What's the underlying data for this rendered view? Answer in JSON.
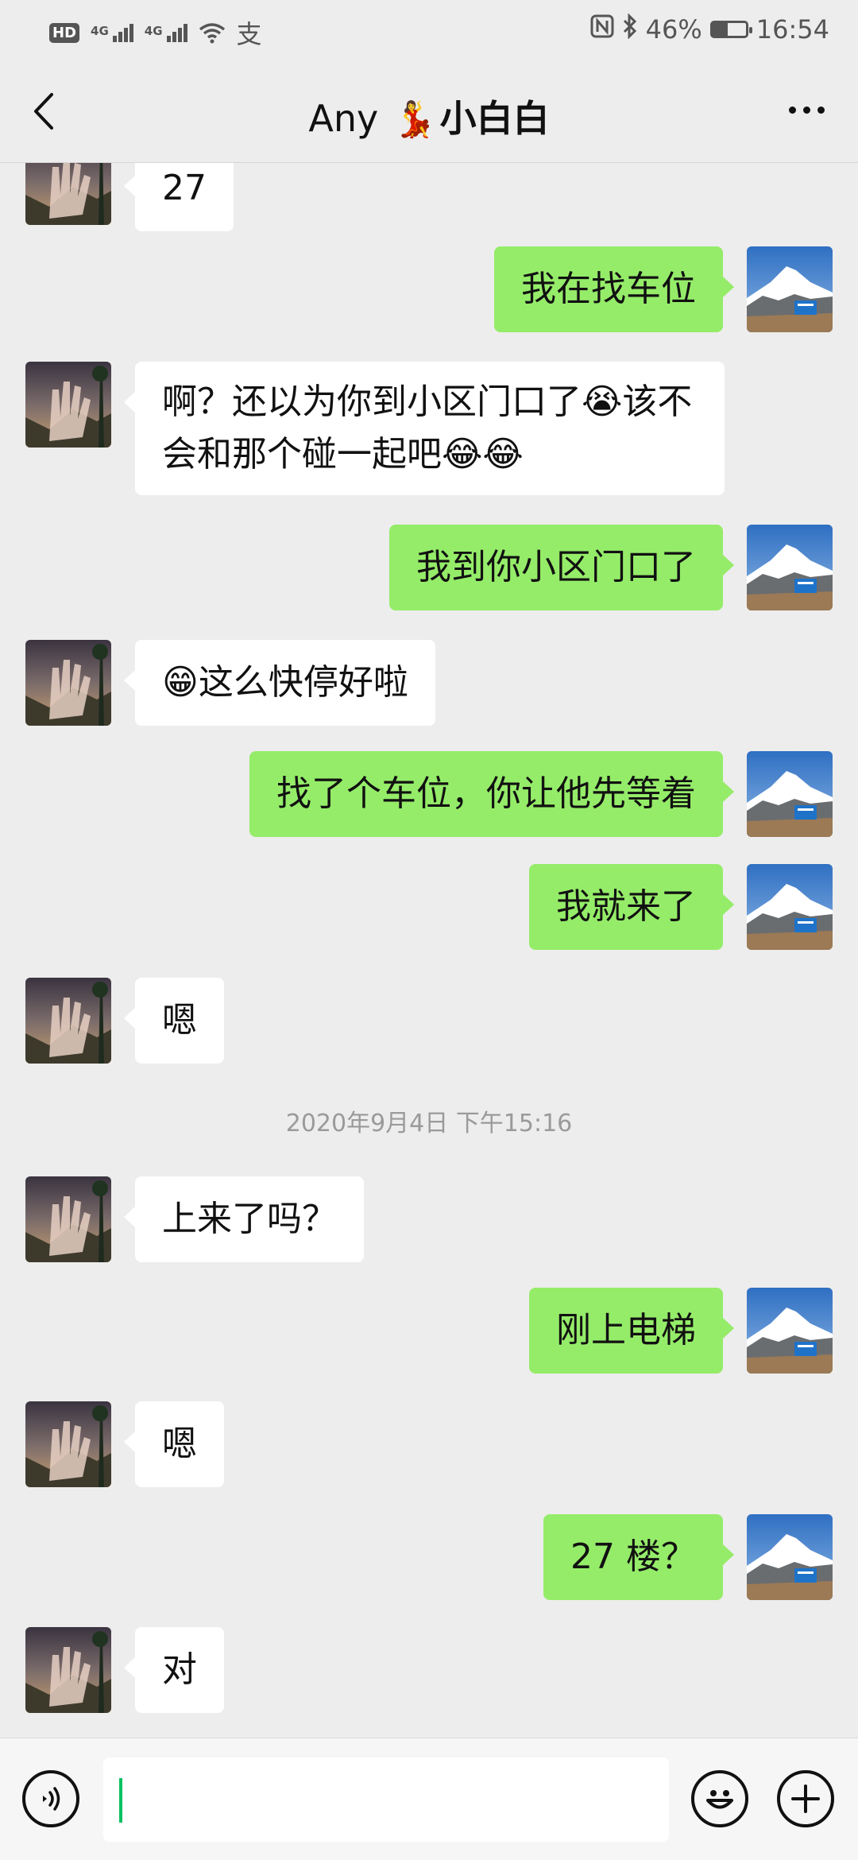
{
  "status_bar": {
    "hd": "HD",
    "net1": "4G",
    "net2": "4G",
    "pay_icon": "支",
    "battery_pct": "46%",
    "battery_level": 0.46,
    "time": "16:54"
  },
  "header": {
    "name_before": "Any",
    "name_emoji": "💃",
    "name_after": "小白白"
  },
  "messages": [
    {
      "side": "left",
      "text": "27"
    },
    {
      "side": "right",
      "text": "我在找车位"
    },
    {
      "side": "left",
      "text": "啊？还以为你到小区门口了😭该不会和那个碰一起吧😂😂"
    },
    {
      "side": "right",
      "text": "我到你小区门口了"
    },
    {
      "side": "left",
      "text": "😁这么快停好啦"
    },
    {
      "side": "right",
      "text": "找了个车位，你让他先等着"
    },
    {
      "side": "right",
      "text": "我就来了"
    },
    {
      "side": "left",
      "text": "嗯"
    },
    {
      "side": "left",
      "text": "上来了吗？"
    },
    {
      "side": "right",
      "text": "刚上电梯"
    },
    {
      "side": "left",
      "text": "嗯"
    },
    {
      "side": "right",
      "text": "27 楼？"
    },
    {
      "side": "left",
      "text": "对"
    }
  ],
  "timestamp": "2020年9月4日 下午15:16",
  "input": {
    "value": ""
  },
  "colors": {
    "self_bubble": "#95ec69",
    "other_bubble": "#ffffff",
    "background": "#ededed",
    "caret": "#07c160"
  }
}
